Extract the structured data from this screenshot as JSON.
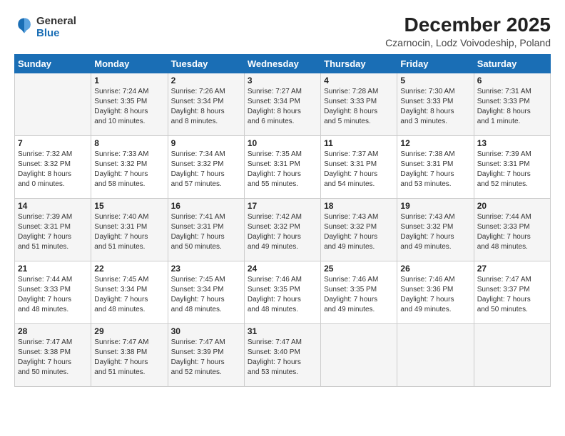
{
  "logo": {
    "general": "General",
    "blue": "Blue"
  },
  "header": {
    "title": "December 2025",
    "subtitle": "Czarnocin, Lodz Voivodeship, Poland"
  },
  "calendar": {
    "weekdays": [
      "Sunday",
      "Monday",
      "Tuesday",
      "Wednesday",
      "Thursday",
      "Friday",
      "Saturday"
    ],
    "weeks": [
      [
        {
          "day": "",
          "info": ""
        },
        {
          "day": "1",
          "info": "Sunrise: 7:24 AM\nSunset: 3:35 PM\nDaylight: 8 hours\nand 10 minutes."
        },
        {
          "day": "2",
          "info": "Sunrise: 7:26 AM\nSunset: 3:34 PM\nDaylight: 8 hours\nand 8 minutes."
        },
        {
          "day": "3",
          "info": "Sunrise: 7:27 AM\nSunset: 3:34 PM\nDaylight: 8 hours\nand 6 minutes."
        },
        {
          "day": "4",
          "info": "Sunrise: 7:28 AM\nSunset: 3:33 PM\nDaylight: 8 hours\nand 5 minutes."
        },
        {
          "day": "5",
          "info": "Sunrise: 7:30 AM\nSunset: 3:33 PM\nDaylight: 8 hours\nand 3 minutes."
        },
        {
          "day": "6",
          "info": "Sunrise: 7:31 AM\nSunset: 3:33 PM\nDaylight: 8 hours\nand 1 minute."
        }
      ],
      [
        {
          "day": "7",
          "info": "Sunrise: 7:32 AM\nSunset: 3:32 PM\nDaylight: 8 hours\nand 0 minutes."
        },
        {
          "day": "8",
          "info": "Sunrise: 7:33 AM\nSunset: 3:32 PM\nDaylight: 7 hours\nand 58 minutes."
        },
        {
          "day": "9",
          "info": "Sunrise: 7:34 AM\nSunset: 3:32 PM\nDaylight: 7 hours\nand 57 minutes."
        },
        {
          "day": "10",
          "info": "Sunrise: 7:35 AM\nSunset: 3:31 PM\nDaylight: 7 hours\nand 55 minutes."
        },
        {
          "day": "11",
          "info": "Sunrise: 7:37 AM\nSunset: 3:31 PM\nDaylight: 7 hours\nand 54 minutes."
        },
        {
          "day": "12",
          "info": "Sunrise: 7:38 AM\nSunset: 3:31 PM\nDaylight: 7 hours\nand 53 minutes."
        },
        {
          "day": "13",
          "info": "Sunrise: 7:39 AM\nSunset: 3:31 PM\nDaylight: 7 hours\nand 52 minutes."
        }
      ],
      [
        {
          "day": "14",
          "info": "Sunrise: 7:39 AM\nSunset: 3:31 PM\nDaylight: 7 hours\nand 51 minutes."
        },
        {
          "day": "15",
          "info": "Sunrise: 7:40 AM\nSunset: 3:31 PM\nDaylight: 7 hours\nand 51 minutes."
        },
        {
          "day": "16",
          "info": "Sunrise: 7:41 AM\nSunset: 3:31 PM\nDaylight: 7 hours\nand 50 minutes."
        },
        {
          "day": "17",
          "info": "Sunrise: 7:42 AM\nSunset: 3:32 PM\nDaylight: 7 hours\nand 49 minutes."
        },
        {
          "day": "18",
          "info": "Sunrise: 7:43 AM\nSunset: 3:32 PM\nDaylight: 7 hours\nand 49 minutes."
        },
        {
          "day": "19",
          "info": "Sunrise: 7:43 AM\nSunset: 3:32 PM\nDaylight: 7 hours\nand 49 minutes."
        },
        {
          "day": "20",
          "info": "Sunrise: 7:44 AM\nSunset: 3:33 PM\nDaylight: 7 hours\nand 48 minutes."
        }
      ],
      [
        {
          "day": "21",
          "info": "Sunrise: 7:44 AM\nSunset: 3:33 PM\nDaylight: 7 hours\nand 48 minutes."
        },
        {
          "day": "22",
          "info": "Sunrise: 7:45 AM\nSunset: 3:34 PM\nDaylight: 7 hours\nand 48 minutes."
        },
        {
          "day": "23",
          "info": "Sunrise: 7:45 AM\nSunset: 3:34 PM\nDaylight: 7 hours\nand 48 minutes."
        },
        {
          "day": "24",
          "info": "Sunrise: 7:46 AM\nSunset: 3:35 PM\nDaylight: 7 hours\nand 48 minutes."
        },
        {
          "day": "25",
          "info": "Sunrise: 7:46 AM\nSunset: 3:35 PM\nDaylight: 7 hours\nand 49 minutes."
        },
        {
          "day": "26",
          "info": "Sunrise: 7:46 AM\nSunset: 3:36 PM\nDaylight: 7 hours\nand 49 minutes."
        },
        {
          "day": "27",
          "info": "Sunrise: 7:47 AM\nSunset: 3:37 PM\nDaylight: 7 hours\nand 50 minutes."
        }
      ],
      [
        {
          "day": "28",
          "info": "Sunrise: 7:47 AM\nSunset: 3:38 PM\nDaylight: 7 hours\nand 50 minutes."
        },
        {
          "day": "29",
          "info": "Sunrise: 7:47 AM\nSunset: 3:38 PM\nDaylight: 7 hours\nand 51 minutes."
        },
        {
          "day": "30",
          "info": "Sunrise: 7:47 AM\nSunset: 3:39 PM\nDaylight: 7 hours\nand 52 minutes."
        },
        {
          "day": "31",
          "info": "Sunrise: 7:47 AM\nSunset: 3:40 PM\nDaylight: 7 hours\nand 53 minutes."
        },
        {
          "day": "",
          "info": ""
        },
        {
          "day": "",
          "info": ""
        },
        {
          "day": "",
          "info": ""
        }
      ]
    ]
  }
}
